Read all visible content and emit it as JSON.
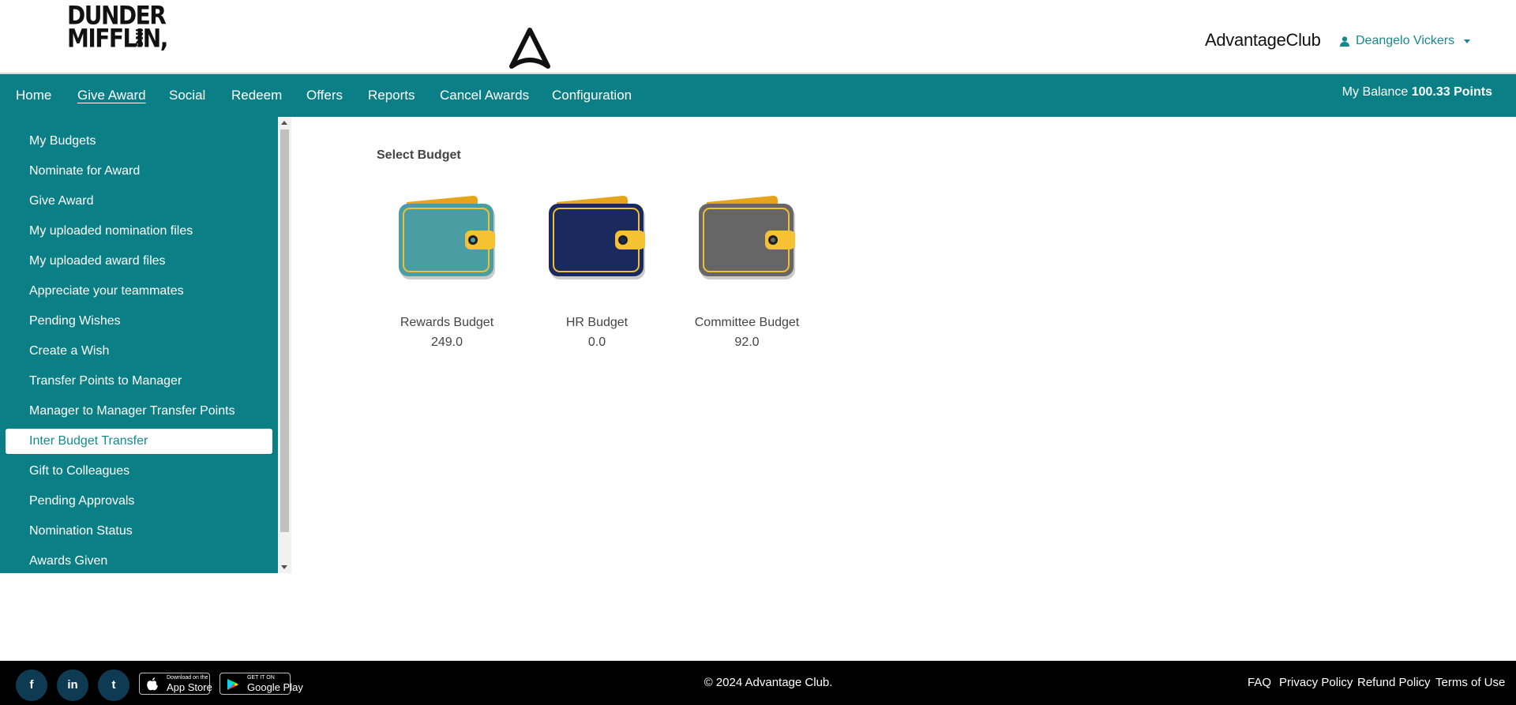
{
  "header": {
    "logo_line1": "DUNDER",
    "logo_line2": "MIFFLIN,",
    "logo_inc": "INC",
    "brand": "AdvantageClub",
    "user_name": "Deangelo Vickers"
  },
  "nav": {
    "items": [
      "Home",
      "Give Award",
      "Social",
      "Redeem",
      "Offers",
      "Reports",
      "Cancel Awards",
      "Configuration"
    ],
    "active": "Give Award",
    "balance_label": "My Balance",
    "balance_value": "100.33 Points"
  },
  "sidebar": {
    "items": [
      "My Budgets",
      "Nominate for Award",
      "Give Award",
      "My uploaded nomination files",
      "My uploaded award files",
      "Appreciate your teammates",
      "Pending Wishes",
      "Create a Wish",
      "Transfer Points to Manager",
      "Manager to Manager Transfer Points",
      "Inter Budget Transfer",
      "Gift to Colleagues",
      "Pending Approvals",
      "Nomination Status",
      "Awards Given"
    ],
    "active": "Inter Budget Transfer"
  },
  "main": {
    "title": "Select Budget",
    "budgets": [
      {
        "name": "Rewards Budget",
        "value": "249.0",
        "color": "#4a9ea3"
      },
      {
        "name": "HR Budget",
        "value": "0.0",
        "color": "#1b2a5e"
      },
      {
        "name": "Committee Budget",
        "value": "92.0",
        "color": "#666666"
      }
    ]
  },
  "footer": {
    "social": [
      "f",
      "in",
      "t"
    ],
    "social_icons": [
      "facebook-icon",
      "linkedin-icon",
      "twitter-icon"
    ],
    "appstore_small": "Download on the",
    "appstore_big": "App Store",
    "googleplay_small": "GET IT ON",
    "googleplay_big": "Google Play",
    "copyright": "© 2024 Advantage Club.",
    "links": [
      "FAQ",
      "Privacy Policy",
      "Refund Policy",
      "Terms of Use"
    ]
  },
  "colors": {
    "primary": "#0b7f86",
    "accent_text": "#138a8f",
    "footer_bg": "#000000"
  }
}
